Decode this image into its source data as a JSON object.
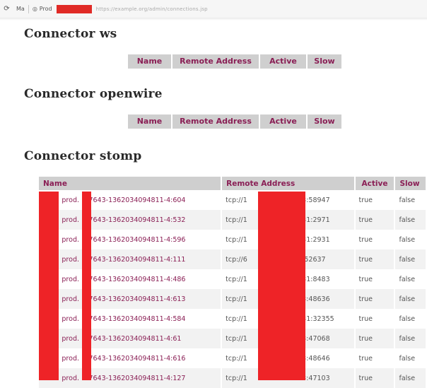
{
  "browser": {
    "back_glyph": "⟳",
    "tab_label": "Ma",
    "tab2_label": "Prod",
    "url": "https://example.org/admin/connections.jsp"
  },
  "sections": {
    "ws": {
      "title": "Connector ws",
      "columns": [
        "Name",
        "Remote Address",
        "Active",
        "Slow"
      ]
    },
    "openwire": {
      "title": "Connector openwire",
      "columns": [
        "Name",
        "Remote Address",
        "Active",
        "Slow"
      ]
    },
    "stomp": {
      "title": "Connector stomp",
      "columns": [
        "Name",
        "Remote Address",
        "Active",
        "Slow"
      ],
      "rows": [
        {
          "name_prefix": "prod.",
          "name_suffix": "-47643-1362034094811-4:604",
          "address_prefix": "tcp://1",
          "address_suffix": "13:58947",
          "active": "true",
          "slow": "false"
        },
        {
          "name_prefix": "prod.",
          "name_suffix": "-47643-1362034094811-4:532",
          "address_prefix": "tcp://1",
          "address_suffix": "131:2971",
          "active": "true",
          "slow": "false"
        },
        {
          "name_prefix": "prod.",
          "name_suffix": "-47643-1362034094811-4:596",
          "address_prefix": "tcp://1",
          "address_suffix": "131:2931",
          "active": "true",
          "slow": "false"
        },
        {
          "name_prefix": "prod.",
          "name_suffix": "-47643-1362034094811-4:111",
          "address_prefix": "tcp://6",
          "address_suffix": "0:52637",
          "active": "true",
          "slow": "false"
        },
        {
          "name_prefix": "prod.",
          "name_suffix": "-47643-1362034094811-4:486",
          "address_prefix": "tcp://1",
          "address_suffix": "131:8483",
          "active": "true",
          "slow": "false"
        },
        {
          "name_prefix": "prod.",
          "name_suffix": "-47643-1362034094811-4:613",
          "address_prefix": "tcp://1",
          "address_suffix": "13:48636",
          "active": "true",
          "slow": "false"
        },
        {
          "name_prefix": "prod.",
          "name_suffix": "-47643-1362034094811-4:584",
          "address_prefix": "tcp://1",
          "address_suffix": "131:32355",
          "active": "true",
          "slow": "false"
        },
        {
          "name_prefix": "prod.",
          "name_suffix": "-47643-1362034094811-4:61",
          "address_prefix": "tcp://1",
          "address_suffix": "13:47068",
          "active": "true",
          "slow": "false"
        },
        {
          "name_prefix": "prod.",
          "name_suffix": "-47643-1362034094811-4:616",
          "address_prefix": "tcp://1",
          "address_suffix": "13:48646",
          "active": "true",
          "slow": "false"
        },
        {
          "name_prefix": "prod.",
          "name_suffix": "-47643-1362034094811-4:127",
          "address_prefix": "tcp://1",
          "address_suffix": "13:47103",
          "active": "true",
          "slow": "false"
        }
      ]
    }
  },
  "colors": {
    "header_bg": "#cfcfcf",
    "header_text": "#8a1f55",
    "redaction": "#ee2327"
  }
}
